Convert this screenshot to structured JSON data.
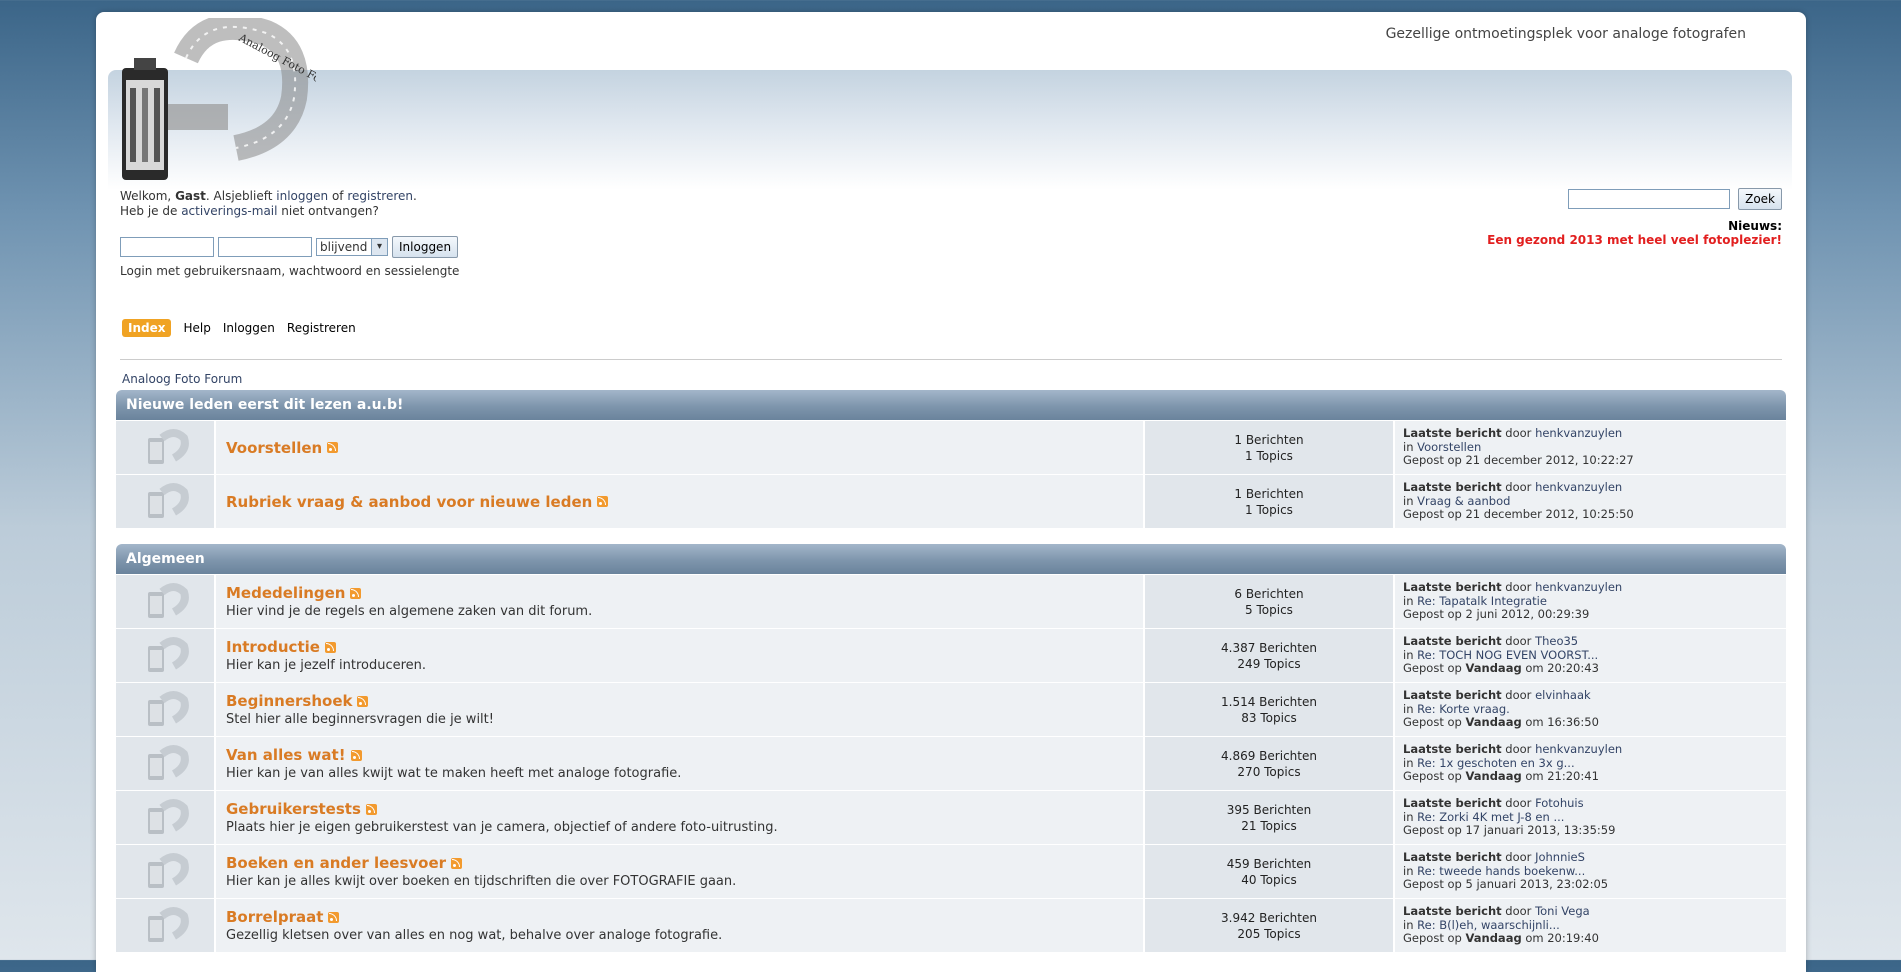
{
  "header": {
    "tagline": "Gezellige ontmoetingsplek voor analoge fotografen",
    "logo_text": "Analoog Foto Forum.nl"
  },
  "user": {
    "welcome_prefix": "Welkom,",
    "guest": "Gast",
    "please": ". Alsjeblieft",
    "login_link": "inloggen",
    "or": "of",
    "register_link": "registreren",
    "activation_prefix": "Heb je de",
    "activation_link": "activerings-mail",
    "activation_suffix": "niet ontvangen?",
    "session_option": "blijvend",
    "login_button": "Inloggen",
    "login_note": "Login met gebruikersnaam, wachtwoord en sessielengte"
  },
  "search": {
    "button": "Zoek",
    "value": ""
  },
  "news": {
    "label": "Nieuws:",
    "text": "Een gezond 2013 met heel veel fotoplezier!"
  },
  "nav": {
    "items": [
      "Index",
      "Help",
      "Inloggen",
      "Registreren"
    ]
  },
  "breadcrumb": "Analoog Foto Forum",
  "categories": [
    {
      "title": "Nieuwe leden eerst dit lezen a.u.b!",
      "boards": [
        {
          "name": "Voorstellen",
          "desc": "",
          "posts": "1 Berichten",
          "topics": "1 Topics",
          "by": "henkvanzuylen",
          "in": "Voorstellen",
          "date_prefix": "Gepost op",
          "date_bold": "",
          "date": "21 december 2012, 10:22:27"
        },
        {
          "name": "Rubriek vraag & aanbod voor nieuwe leden",
          "desc": "",
          "posts": "1 Berichten",
          "topics": "1 Topics",
          "by": "henkvanzuylen",
          "in": "Vraag & aanbod",
          "date_prefix": "Gepost op",
          "date_bold": "",
          "date": "21 december 2012, 10:25:50"
        }
      ]
    },
    {
      "title": "Algemeen",
      "boards": [
        {
          "name": "Mededelingen",
          "desc": "Hier vind je de regels en algemene zaken van dit forum.",
          "posts": "6 Berichten",
          "topics": "5 Topics",
          "by": "henkvanzuylen",
          "in": "Re: Tapatalk Integratie",
          "date_prefix": "Gepost op",
          "date_bold": "",
          "date": "2 juni 2012, 00:29:39"
        },
        {
          "name": "Introductie",
          "desc": "Hier kan je jezelf introduceren.",
          "posts": "4.387 Berichten",
          "topics": "249 Topics",
          "by": "Theo35",
          "in": "Re: TOCH NOG EVEN VOORST...",
          "date_prefix": "Gepost op",
          "date_bold": "Vandaag",
          "date": "om 20:20:43"
        },
        {
          "name": "Beginnershoek",
          "desc": "Stel hier alle beginnersvragen die je wilt!",
          "posts": "1.514 Berichten",
          "topics": "83 Topics",
          "by": "elvinhaak",
          "in": "Re: Korte vraag.",
          "date_prefix": "Gepost op",
          "date_bold": "Vandaag",
          "date": "om 16:36:50"
        },
        {
          "name": "Van alles wat!",
          "desc": "Hier kan je van alles kwijt wat te maken heeft met analoge fotografie.",
          "posts": "4.869 Berichten",
          "topics": "270 Topics",
          "by": "henkvanzuylen",
          "in": "Re: 1x geschoten en 3x g...",
          "date_prefix": "Gepost op",
          "date_bold": "Vandaag",
          "date": "om 21:20:41"
        },
        {
          "name": "Gebruikerstests",
          "desc": "Plaats hier je eigen gebruikerstest van je camera, objectief of andere foto-uitrusting.",
          "posts": "395 Berichten",
          "topics": "21 Topics",
          "by": "Fotohuis",
          "in": "Re: Zorki 4K met J-8 en ...",
          "date_prefix": "Gepost op",
          "date_bold": "",
          "date": "17 januari 2013, 13:35:59"
        },
        {
          "name": "Boeken en ander leesvoer",
          "desc": "Hier kan je alles kwijt over boeken en tijdschriften die over FOTOGRAFIE gaan.",
          "posts": "459 Berichten",
          "topics": "40 Topics",
          "by": "JohnnieS",
          "in": "Re: tweede hands boekenw...",
          "date_prefix": "Gepost op",
          "date_bold": "",
          "date": "5 januari 2013, 23:02:05"
        },
        {
          "name": "Borrelpraat",
          "desc": "Gezellig kletsen over van alles en nog wat, behalve over analoge fotografie.",
          "posts": "3.942 Berichten",
          "topics": "205 Topics",
          "by": "Toni Vega",
          "in": "Re: B(l)eh, waarschijnli...",
          "date_prefix": "Gepost op",
          "date_bold": "Vandaag",
          "date": "om 20:19:40"
        }
      ]
    }
  ],
  "labels": {
    "last_post": "Laatste bericht",
    "by": "door",
    "in": "in"
  }
}
